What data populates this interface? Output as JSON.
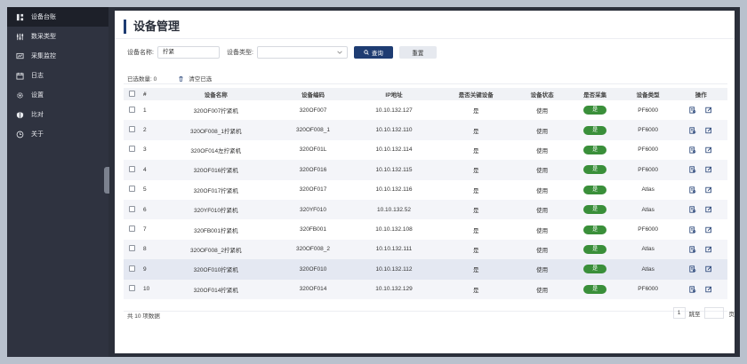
{
  "sidebar": {
    "items": [
      {
        "label": "设备台账",
        "icon": "device-ledger-icon",
        "active": true
      },
      {
        "label": "数采类型",
        "icon": "sliders-icon"
      },
      {
        "label": "采集监控",
        "icon": "monitor-chart-icon"
      },
      {
        "label": "日志",
        "icon": "calendar-icon"
      },
      {
        "label": "设置",
        "icon": "gear-icon"
      },
      {
        "label": "比对",
        "icon": "compare-icon"
      },
      {
        "label": "关于",
        "icon": "info-clock-icon"
      }
    ]
  },
  "page": {
    "title": "设备管理"
  },
  "filters": {
    "name_label": "设备名称:",
    "name_value": "拧紧",
    "type_label": "设备类型:",
    "type_value": "",
    "search_label": "查询",
    "reset_label": "重置"
  },
  "selection": {
    "count_text": "已选数量: 0",
    "clear_label": "清空已选"
  },
  "table": {
    "headers": [
      "#",
      "设备名称",
      "设备编码",
      "IP地址",
      "是否关键设备",
      "设备状态",
      "是否采集",
      "设备类型",
      "操作"
    ],
    "rows": [
      {
        "no": "1",
        "name": "320OF007拧紧机",
        "code": "320OF007",
        "ip": "10.10.132.127",
        "key": "是",
        "status": "使用",
        "collect": "是",
        "type": "PF6000"
      },
      {
        "no": "2",
        "name": "320OF008_1拧紧机",
        "code": "320OF008_1",
        "ip": "10.10.132.110",
        "key": "是",
        "status": "使用",
        "collect": "是",
        "type": "PF6000"
      },
      {
        "no": "3",
        "name": "320OF014左拧紧机",
        "code": "320OF01L",
        "ip": "10.10.132.114",
        "key": "是",
        "status": "使用",
        "collect": "是",
        "type": "PF6000"
      },
      {
        "no": "4",
        "name": "320OF016拧紧机",
        "code": "320OF016",
        "ip": "10.10.132.115",
        "key": "是",
        "status": "使用",
        "collect": "是",
        "type": "PF6000"
      },
      {
        "no": "5",
        "name": "320OF017拧紧机",
        "code": "320OF017",
        "ip": "10.10.132.116",
        "key": "是",
        "status": "使用",
        "collect": "是",
        "type": "Atlas"
      },
      {
        "no": "6",
        "name": "320YF010拧紧机",
        "code": "320YF010",
        "ip": "10.10.132.52",
        "key": "是",
        "status": "使用",
        "collect": "是",
        "type": "Atlas"
      },
      {
        "no": "7",
        "name": "320FB001拧紧机",
        "code": "320FB001",
        "ip": "10.10.132.108",
        "key": "是",
        "status": "使用",
        "collect": "是",
        "type": "PF6000"
      },
      {
        "no": "8",
        "name": "320OF008_2拧紧机",
        "code": "320OF008_2",
        "ip": "10.10.132.111",
        "key": "是",
        "status": "使用",
        "collect": "是",
        "type": "Atlas"
      },
      {
        "no": "9",
        "name": "320OF010拧紧机",
        "code": "320OF010",
        "ip": "10.10.132.112",
        "key": "是",
        "status": "使用",
        "collect": "是",
        "type": "Atlas",
        "highlight": true
      },
      {
        "no": "10",
        "name": "320OF014拧紧机",
        "code": "320OF014",
        "ip": "10.10.132.129",
        "key": "是",
        "status": "使用",
        "collect": "是",
        "type": "PF6000"
      }
    ]
  },
  "footer": {
    "total_text": "共 10 项数据",
    "current_page": "1",
    "jump_label": "跳至",
    "page_unit": "页"
  },
  "colors": {
    "accent": "#1e3c72",
    "pill_green": "#3a8f3a",
    "sidebar_bg": "#2f3340"
  }
}
